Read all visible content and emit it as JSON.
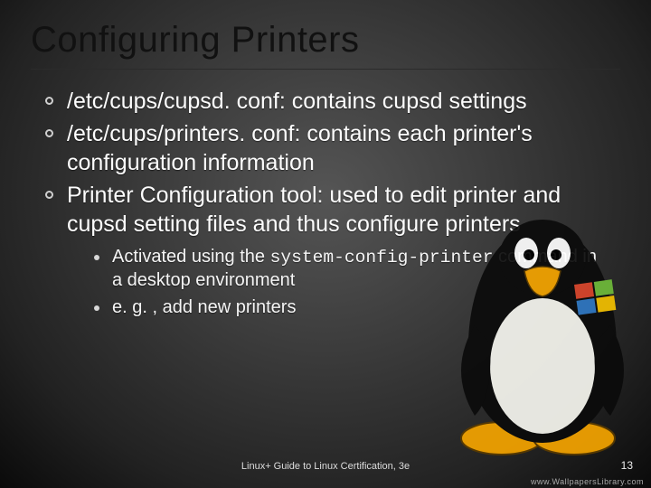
{
  "title": "Configuring Printers",
  "bullets": {
    "b1": "/etc/cups/cupsd. conf: contains cupsd settings",
    "b2": "/etc/cups/printers. conf: contains each printer's configuration information",
    "b3": "Printer Configuration tool: used to edit printer and cupsd setting files and thus configure printers",
    "sub1a": "Activated using the ",
    "sub1b_code": "system-config-printer",
    "sub1c": " command in a desktop environment",
    "sub2": "e. g. , add new printers"
  },
  "footer": "Linux+ Guide to Linux Certification, 3e",
  "page": "13",
  "watermark": "www.WallpapersLibrary.com"
}
